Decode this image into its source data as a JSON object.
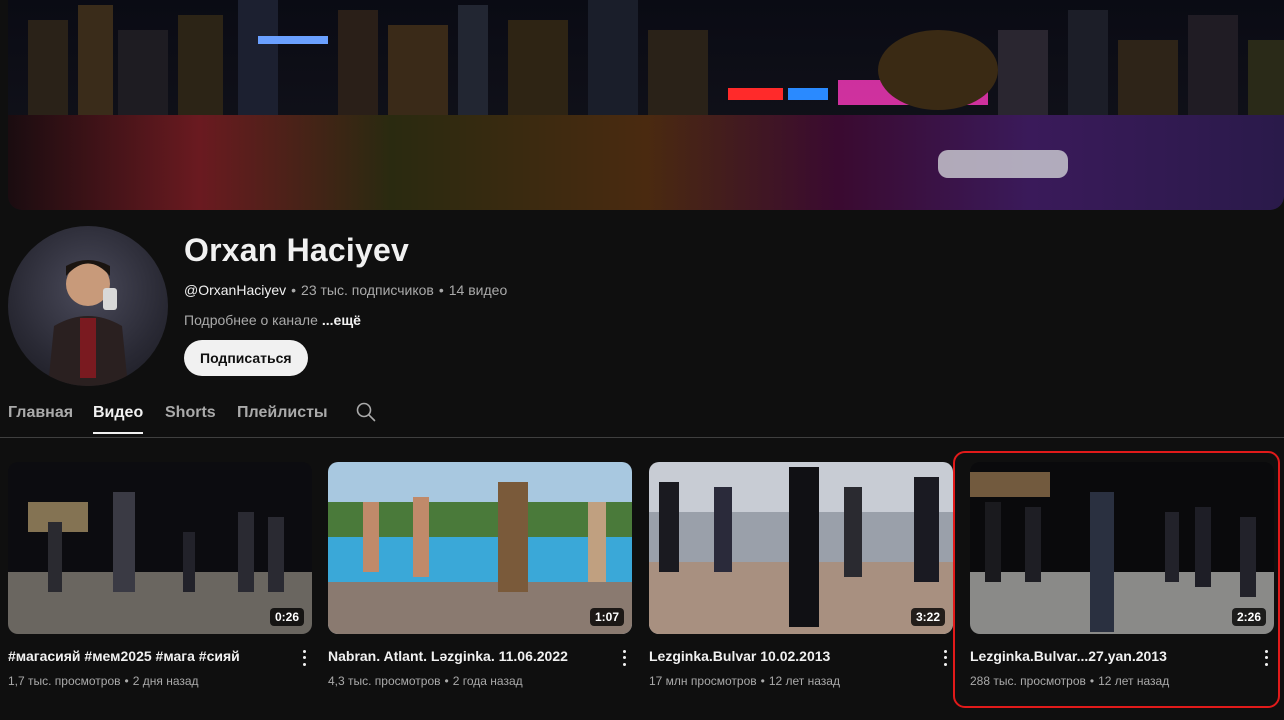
{
  "channel": {
    "name": "Orxan Haciyev",
    "handle": "@OrxanHaciyev",
    "subscribers": "23 тыс. подписчиков",
    "video_count": "14 видео",
    "about": "Подробнее о канале",
    "about_more": "...ещё",
    "subscribe_label": "Подписаться",
    "meta_separator": "•"
  },
  "tabs": [
    {
      "label": "Главная",
      "active": false
    },
    {
      "label": "Видео",
      "active": true
    },
    {
      "label": "Shorts",
      "active": false
    },
    {
      "label": "Плейлисты",
      "active": false
    }
  ],
  "icons": {
    "search": "search-icon",
    "more": "more-vert-icon"
  },
  "videos": [
    {
      "title": "#магасияй #мем2025 #мага #сияй",
      "views": "1,7 тыс. просмотров",
      "age": "2 дня назад",
      "duration": "0:26"
    },
    {
      "title": "Nabran. Atlant. Ləzginka. 11.06.2022",
      "views": "4,3 тыс. просмотров",
      "age": "2 года назад",
      "duration": "1:07"
    },
    {
      "title": "Lezginka.Bulvar 10.02.2013",
      "views": "17 млн просмотров",
      "age": "12 лет назад",
      "duration": "3:22"
    },
    {
      "title": "Lezginka.Bulvar...27.yan.2013",
      "views": "288 тыс. просмотров",
      "age": "12 лет назад",
      "duration": "2:26"
    }
  ],
  "colors": {
    "background": "#0f0f0f",
    "highlight": "#e11a1a"
  }
}
